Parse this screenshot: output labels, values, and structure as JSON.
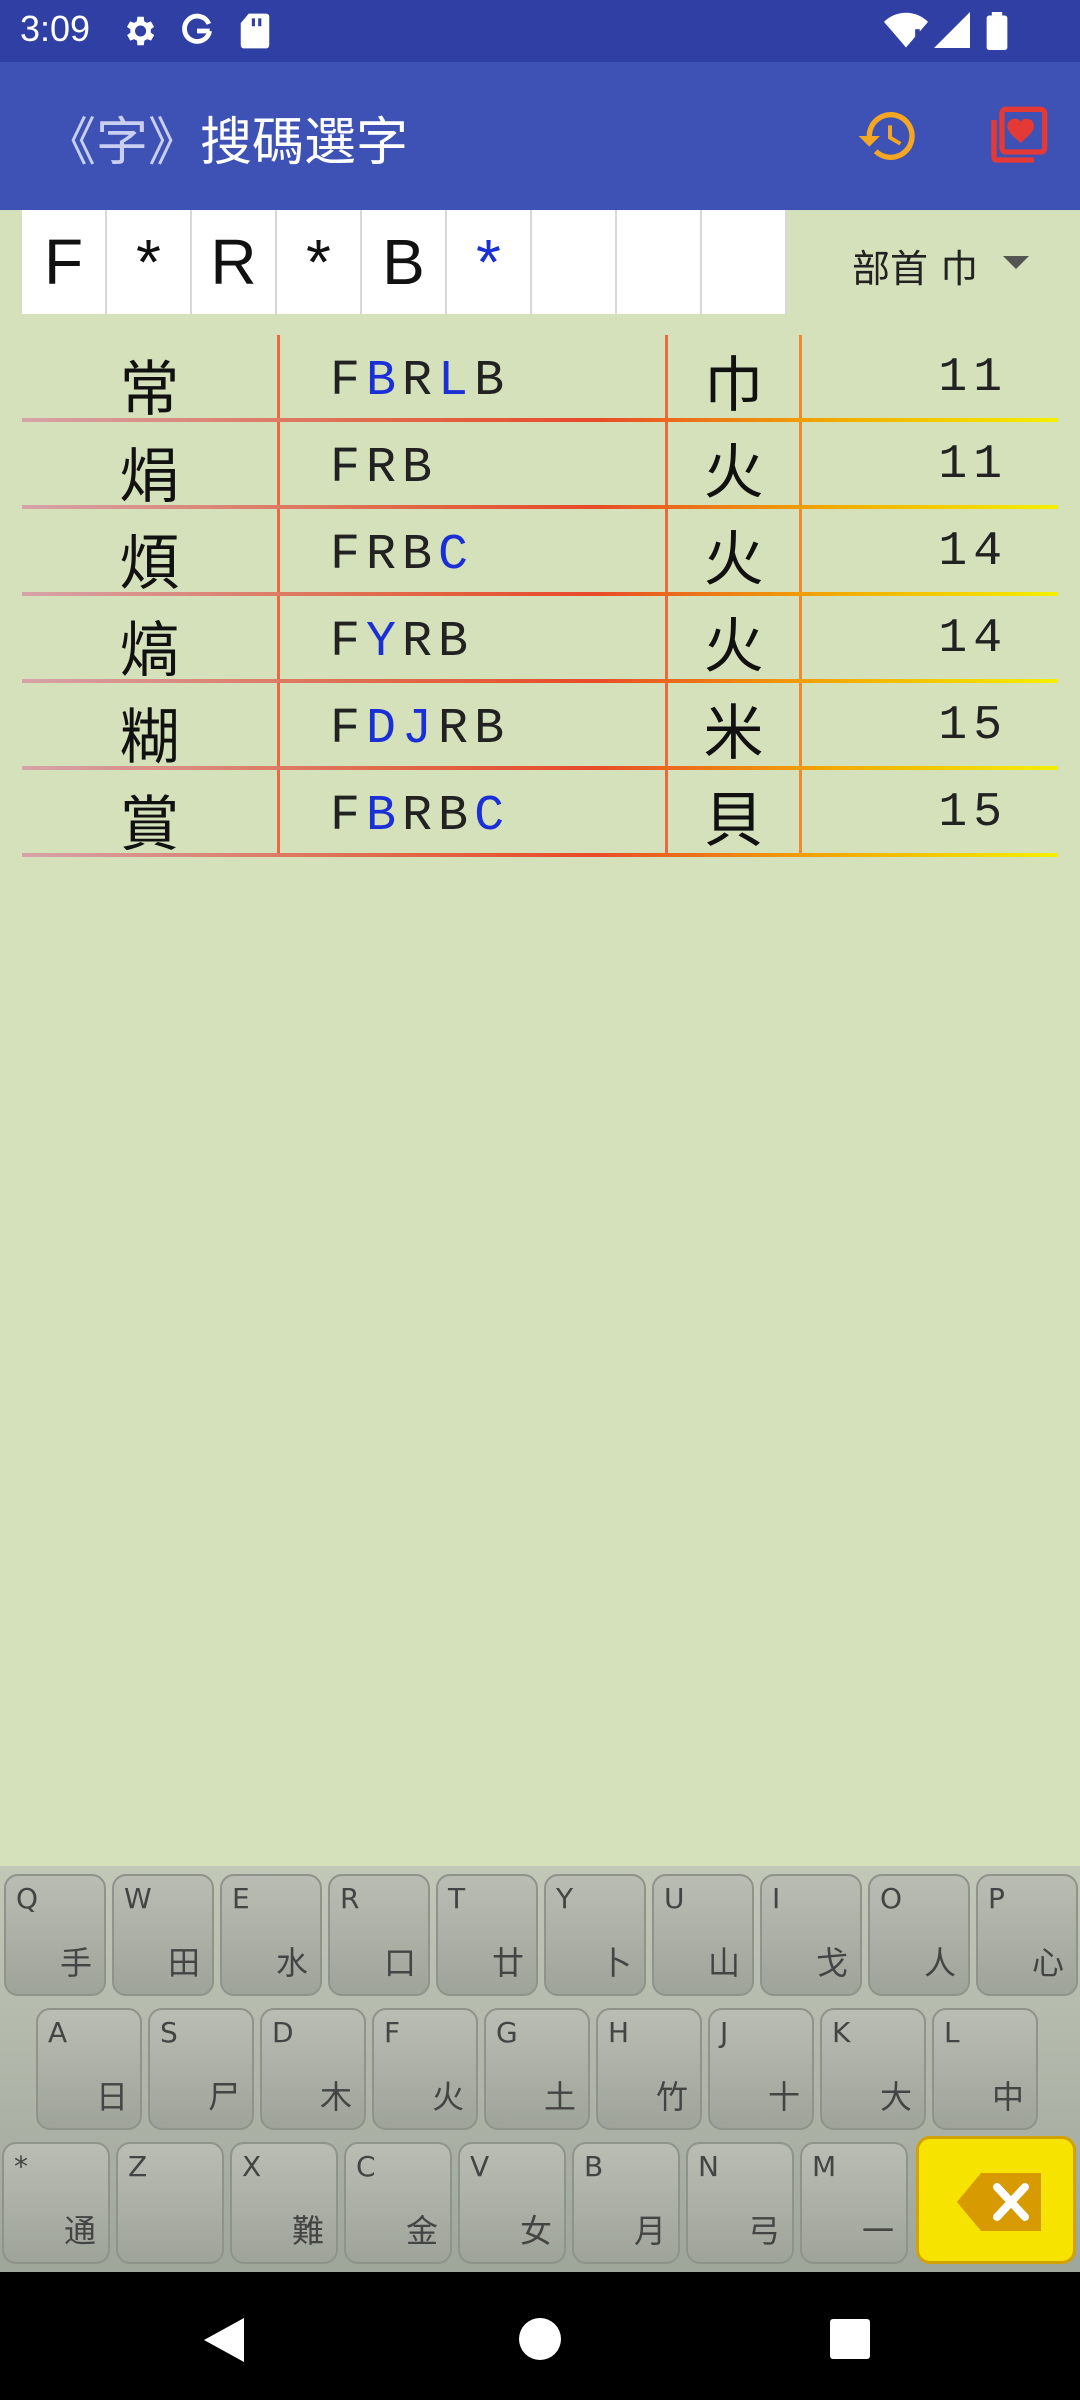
{
  "status_bar": {
    "time": "3:09",
    "icons": [
      "settings-icon",
      "google-icon",
      "sd-card-icon",
      "wifi-icon",
      "signal-icon",
      "battery-icon"
    ]
  },
  "app_bar": {
    "title_prefix": "《字》",
    "title": "搜碼選字",
    "history_icon": "history-icon",
    "favorites_icon": "favorites-icon",
    "accent_color": "#f5a623",
    "fav_color": "#e53935"
  },
  "code_input": {
    "cells": [
      "F",
      "*",
      "R",
      "*",
      "B",
      "*",
      "",
      "",
      ""
    ]
  },
  "radical_filter": {
    "label": "部首 巾"
  },
  "results": [
    {
      "char": "常",
      "code": [
        {
          "t": "F",
          "h": false
        },
        {
          "t": "B",
          "h": true
        },
        {
          "t": "R",
          "h": false
        },
        {
          "t": "L",
          "h": true
        },
        {
          "t": "B",
          "h": false
        }
      ],
      "radical": "巾",
      "strokes": "11"
    },
    {
      "char": "焆",
      "code": [
        {
          "t": "F",
          "h": false
        },
        {
          "t": "R",
          "h": false
        },
        {
          "t": "B",
          "h": false
        }
      ],
      "radical": "火",
      "strokes": "11"
    },
    {
      "char": "煩",
      "code": [
        {
          "t": "F",
          "h": false
        },
        {
          "t": "R",
          "h": false
        },
        {
          "t": "B",
          "h": false
        },
        {
          "t": "C",
          "h": true
        }
      ],
      "radical": "火",
      "strokes": "14"
    },
    {
      "char": "熇",
      "code": [
        {
          "t": "F",
          "h": false
        },
        {
          "t": "Y",
          "h": true
        },
        {
          "t": "R",
          "h": false
        },
        {
          "t": "B",
          "h": false
        }
      ],
      "radical": "火",
      "strokes": "14"
    },
    {
      "char": "糊",
      "code": [
        {
          "t": "F",
          "h": false
        },
        {
          "t": "D",
          "h": true
        },
        {
          "t": "J",
          "h": true
        },
        {
          "t": "R",
          "h": false
        },
        {
          "t": "B",
          "h": false
        }
      ],
      "radical": "米",
      "strokes": "15"
    },
    {
      "char": "賞",
      "code": [
        {
          "t": "F",
          "h": false
        },
        {
          "t": "B",
          "h": true
        },
        {
          "t": "R",
          "h": false
        },
        {
          "t": "B",
          "h": false
        },
        {
          "t": "C",
          "h": true
        }
      ],
      "radical": "貝",
      "strokes": "15"
    }
  ],
  "keyboard": {
    "rows": [
      [
        {
          "en": "Q",
          "zh": "手"
        },
        {
          "en": "W",
          "zh": "田"
        },
        {
          "en": "E",
          "zh": "水"
        },
        {
          "en": "R",
          "zh": "口"
        },
        {
          "en": "T",
          "zh": "廿"
        },
        {
          "en": "Y",
          "zh": "卜"
        },
        {
          "en": "U",
          "zh": "山"
        },
        {
          "en": "I",
          "zh": "戈"
        },
        {
          "en": "O",
          "zh": "人"
        },
        {
          "en": "P",
          "zh": "心"
        }
      ],
      [
        {
          "en": "A",
          "zh": "日"
        },
        {
          "en": "S",
          "zh": "尸"
        },
        {
          "en": "D",
          "zh": "木"
        },
        {
          "en": "F",
          "zh": "火"
        },
        {
          "en": "G",
          "zh": "土"
        },
        {
          "en": "H",
          "zh": "竹"
        },
        {
          "en": "J",
          "zh": "十"
        },
        {
          "en": "K",
          "zh": "大"
        },
        {
          "en": "L",
          "zh": "中"
        }
      ],
      [
        {
          "en": "*",
          "zh": "通"
        },
        {
          "en": "Z",
          "zh": ""
        },
        {
          "en": "X",
          "zh": "難"
        },
        {
          "en": "C",
          "zh": "金"
        },
        {
          "en": "V",
          "zh": "女"
        },
        {
          "en": "B",
          "zh": "月"
        },
        {
          "en": "N",
          "zh": "弓"
        },
        {
          "en": "M",
          "zh": "一"
        }
      ]
    ],
    "delete_icon": "backspace-icon"
  },
  "nav_bar": {
    "icons": [
      "back-icon",
      "home-icon",
      "recents-icon"
    ]
  }
}
